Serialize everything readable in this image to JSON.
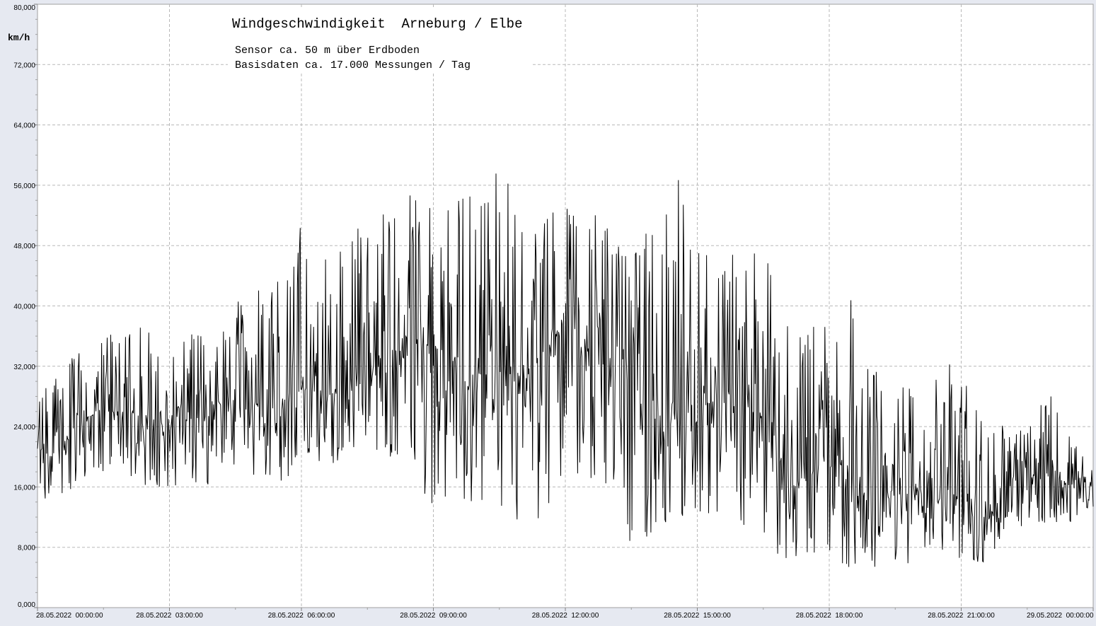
{
  "chart_data": {
    "type": "line",
    "title": "Windgeschwindigkeit  Arneburg / Elbe",
    "subtitle_lines": [
      "Sensor ca. 50 m über Erdboden",
      "Basisdaten ca. 17.000 Messungen / Tag"
    ],
    "ylabel": "km/h",
    "ylim": [
      0,
      80
    ],
    "y_ticks": [
      {
        "value": 0,
        "label": "0,000"
      },
      {
        "value": 8,
        "label": "8,000"
      },
      {
        "value": 16,
        "label": "16,000"
      },
      {
        "value": 24,
        "label": "24,000"
      },
      {
        "value": 32,
        "label": "32,000"
      },
      {
        "value": 40,
        "label": "40,000"
      },
      {
        "value": 48,
        "label": "48,000"
      },
      {
        "value": 56,
        "label": "56,000"
      },
      {
        "value": 64,
        "label": "64,000"
      },
      {
        "value": 72,
        "label": "72,000"
      },
      {
        "value": 80,
        "label": "80,000"
      }
    ],
    "xlim_hours": [
      0,
      24
    ],
    "x_ticks": [
      {
        "hour": 0,
        "label": "28.05.2022  00:00:00"
      },
      {
        "hour": 3,
        "label": "28.05.2022  03:00:00"
      },
      {
        "hour": 6,
        "label": "28.05.2022  06:00:00"
      },
      {
        "hour": 9,
        "label": "28.05.2022  09:00:00"
      },
      {
        "hour": 12,
        "label": "28.05.2022  12:00:00"
      },
      {
        "hour": 15,
        "label": "28.05.2022  15:00:00"
      },
      {
        "hour": 18,
        "label": "28.05.2022  18:00:00"
      },
      {
        "hour": 21,
        "label": "28.05.2022  21:00:00"
      },
      {
        "hour": 24,
        "label": "29.05.2022  00:00:00"
      }
    ],
    "grid": true,
    "series": [
      {
        "color": "#000000",
        "hours": [
          0,
          0.5,
          1,
          1.5,
          2,
          2.5,
          3,
          3.5,
          4,
          4.5,
          5,
          5.5,
          6,
          6.5,
          7,
          7.5,
          8,
          8.5,
          9,
          9.5,
          10,
          10.5,
          11,
          11.5,
          12,
          12.5,
          13,
          13.5,
          14,
          14.5,
          15,
          15.5,
          16,
          16.5,
          17,
          17.5,
          18,
          18.5,
          19,
          19.5,
          20,
          20.5,
          21,
          21.5,
          22,
          22.5,
          23,
          23.5,
          24
        ],
        "mean": [
          22,
          21,
          25,
          26,
          26,
          25,
          25,
          25,
          26,
          26,
          27,
          26,
          29,
          28,
          29,
          31,
          32,
          34,
          35,
          32,
          31,
          31,
          30,
          32,
          39,
          34,
          32,
          30,
          25,
          26,
          26,
          28,
          27,
          25,
          18,
          17,
          22,
          17,
          14,
          15,
          15,
          18,
          14,
          12,
          12,
          17,
          18,
          16,
          16
        ],
        "min": [
          14,
          15,
          16,
          17,
          17,
          16,
          16,
          16,
          16,
          17,
          17,
          15,
          20,
          18,
          19,
          20,
          20,
          18,
          13,
          14,
          14,
          13,
          11,
          11,
          18,
          17,
          16,
          8,
          10,
          12,
          12,
          12,
          11,
          8,
          6,
          7,
          7,
          5,
          4,
          5,
          6,
          7,
          6,
          6,
          7,
          11,
          11,
          11,
          12
        ],
        "max": [
          30,
          32,
          34,
          37,
          38,
          39,
          37,
          37,
          37,
          41,
          42,
          44,
          51,
          46,
          48,
          52,
          55,
          55,
          53,
          54,
          55,
          60,
          52,
          51,
          55,
          55,
          51,
          47,
          52,
          59,
          48,
          46,
          48,
          48,
          38,
          36,
          41,
          43,
          32,
          30,
          29,
          33,
          33,
          25,
          24,
          24,
          30,
          22,
          22
        ],
        "spike_peak_values": [
          59.5,
          58.5,
          55,
          54.9,
          54.5,
          51,
          49
        ]
      }
    ]
  }
}
